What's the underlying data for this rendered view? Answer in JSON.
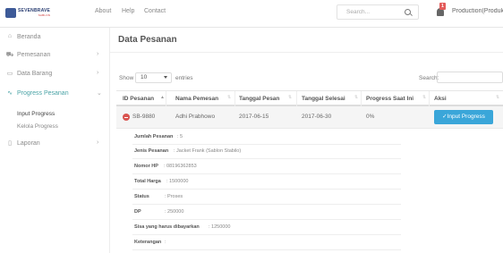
{
  "brand": {
    "name": "SEVENBRAVE",
    "tagline": "SABLON"
  },
  "nav": {
    "about": "About",
    "help": "Help",
    "contact": "Contact"
  },
  "header": {
    "search_placeholder": "Search...",
    "notification_count": "1",
    "user_name": "Production(Produksi)"
  },
  "sidebar": {
    "items": [
      {
        "label": "Beranda",
        "icon": "home-icon"
      },
      {
        "label": "Pemesanan",
        "icon": "cart-icon"
      },
      {
        "label": "Data Barang",
        "icon": "calendar-icon"
      },
      {
        "label": "Progress Pesanan",
        "icon": "activity-icon"
      },
      {
        "label": "Laporan",
        "icon": "bookmark-icon"
      }
    ],
    "sub_items": [
      "Input Progress",
      "Kelola Progress"
    ]
  },
  "main": {
    "title": "Data Pesanan",
    "show_label": "Show",
    "show_value": "10",
    "entries_label": "entries",
    "search_label": "Search:",
    "columns": [
      "ID Pesanan",
      "Nama Pemesan",
      "Tanggal Pesan",
      "Tanggal Selesai",
      "Progress Saat Ini",
      "Aksi"
    ],
    "row": {
      "id": "SB-9880",
      "nama": "Adhi Prabhowo",
      "tgl_pesan": "2017-06-15",
      "tgl_selesai": "2017-06-30",
      "progress": "0%",
      "action": "✓Input Progress"
    },
    "details": [
      {
        "key": "Jumlah Pesanan",
        "value": ": 5"
      },
      {
        "key": "Jenis Pesanan",
        "value": ": Jacket Frank (Sablon Stabilo)"
      },
      {
        "key": "Nomor HP",
        "value": ": 08196362853"
      },
      {
        "key": "Total Harga",
        "value": ": 1500000"
      },
      {
        "key": "Status",
        "value": ": Proses"
      },
      {
        "key": "DP",
        "value": ": 250000"
      },
      {
        "key": "Sisa yang harus dibayarkan",
        "value": ": 1250000"
      },
      {
        "key": "Keterangan",
        "value": ":"
      }
    ]
  }
}
